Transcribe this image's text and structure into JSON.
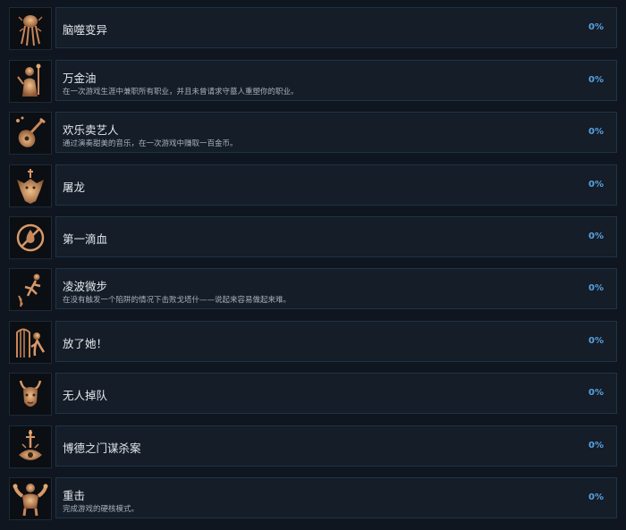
{
  "achievements": [
    {
      "title": "脑噬变异",
      "description": "",
      "percent": "0%",
      "icon": "mind-flayer-icon"
    },
    {
      "title": "万金油",
      "description": "在一次游戏生涯中兼职所有职业，并且未曾请求守墓人重塑你的职业。",
      "percent": "0%",
      "icon": "warrior-mage-icon"
    },
    {
      "title": "欢乐卖艺人",
      "description": "通过演奏甜美的音乐，在一次游戏中赚取一百金币。",
      "percent": "0%",
      "icon": "lute-icon"
    },
    {
      "title": "屠龙",
      "description": "",
      "percent": "0%",
      "icon": "dragon-head-icon"
    },
    {
      "title": "第一滴血",
      "description": "",
      "percent": "0%",
      "icon": "blood-drop-icon"
    },
    {
      "title": "凌波微步",
      "description": "在没有触发一个陷阱的情况下击败戈塔什——说起来容易做起来难。",
      "percent": "0%",
      "icon": "trap-dodge-icon"
    },
    {
      "title": "放了她！",
      "description": "",
      "percent": "0%",
      "icon": "cage-release-icon"
    },
    {
      "title": "无人掉队",
      "description": "",
      "percent": "0%",
      "icon": "horned-devil-icon"
    },
    {
      "title": "博德之门谋杀案",
      "description": "",
      "percent": "0%",
      "icon": "dagger-murder-icon"
    },
    {
      "title": "重击",
      "description": "完成游戏的硬核模式。",
      "percent": "0%",
      "icon": "muscled-warrior-icon"
    }
  ]
}
